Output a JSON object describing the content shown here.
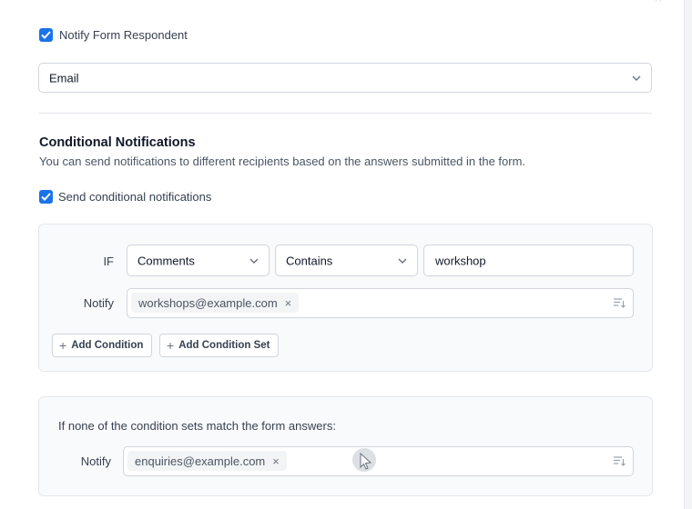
{
  "notify_respondent": {
    "checked": true,
    "label": "Notify Form Respondent",
    "channel_select": "Email"
  },
  "conditional": {
    "title": "Conditional Notifications",
    "description": "You can send notifications to different recipients based on the answers submitted in the form.",
    "enable_checked": true,
    "enable_label": "Send conditional notifications",
    "condition_set": {
      "if_label": "IF",
      "field_select": "Comments",
      "operator_select": "Contains",
      "value_input": "workshop",
      "notify_label": "Notify",
      "recipients": [
        "workshops@example.com"
      ],
      "remove_glyph": "×",
      "add_condition_label": "Add Condition",
      "add_condition_set_label": "Add Condition Set"
    },
    "fallback": {
      "text": "If none of the condition sets match the form answers:",
      "notify_label": "Notify",
      "recipients": [
        "enquiries@example.com"
      ],
      "remove_glyph": "×"
    }
  },
  "colors": {
    "accent": "#1a73e8",
    "card_bg": "#f9fafb",
    "border": "#d1d5db"
  }
}
